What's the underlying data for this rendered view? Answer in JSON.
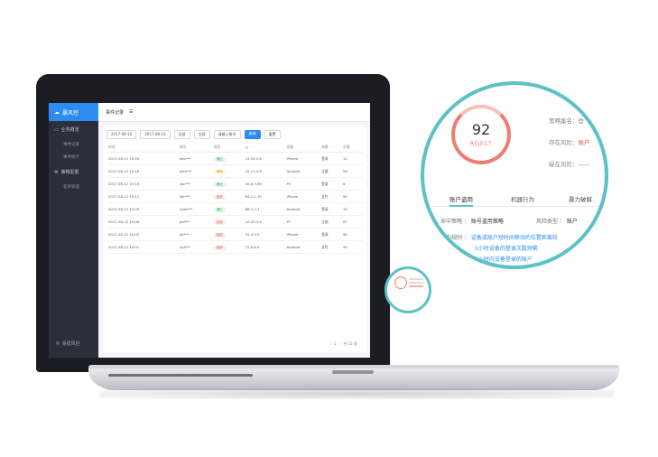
{
  "sidebar": {
    "brand": "暴风控",
    "items": [
      {
        "label": "业务概览",
        "icon": "monitor-icon"
      },
      {
        "label": "事件记录",
        "icon": "list-icon"
      },
      {
        "label": "事件统计",
        "icon": "chart-icon"
      },
      {
        "label": "策略配置",
        "icon": "gear-icon"
      },
      {
        "label": "名单管理",
        "icon": "user-icon"
      }
    ],
    "footer": "易盾风控"
  },
  "topbar": {
    "title": "事件记录"
  },
  "filters": {
    "time": "2017-08-10",
    "to": "2017-08-12",
    "scene": "全部",
    "result": "全部",
    "search_placeholder": "请输入账号",
    "search_button": "查询",
    "reset": "重置"
  },
  "table": {
    "headers": [
      "时间",
      "账号",
      "风险",
      "IP",
      "设备",
      "场景",
      "分值"
    ],
    "rows": [
      [
        "2017-08-12 10:20",
        "abc***",
        "通过",
        "12.34.5.6",
        "iPhone",
        "登录",
        "12"
      ],
      [
        "2017-08-12 10:18",
        "qwe***",
        "审核",
        "22.11.3.8",
        "Android",
        "注册",
        "56"
      ],
      [
        "2017-08-12 10:15",
        "zxc***",
        "通过",
        "45.6.7.89",
        "PC",
        "登录",
        "8"
      ],
      [
        "2017-08-12 10:12",
        "hjk***",
        "拒绝",
        "63.2.1.10",
        "iPhone",
        "支付",
        "92"
      ],
      [
        "2017-08-12 10:09",
        "mnb***",
        "通过",
        "88.1.2.3",
        "Android",
        "登录",
        "15"
      ],
      [
        "2017-08-12 10:06",
        "poi***",
        "拒绝",
        "10.20.3.4",
        "PC",
        "注册",
        "87"
      ],
      [
        "2017-08-12 10:03",
        "lkj***",
        "拒绝",
        "31.4.5.9",
        "iPhone",
        "登录",
        "90"
      ],
      [
        "2017-08-12 10:01",
        "uyt***",
        "拒绝",
        "72.8.6.5",
        "Android",
        "支付",
        "95"
      ]
    ],
    "risk_colors": {
      "通过": "green",
      "审核": "yellow",
      "拒绝": "red"
    }
  },
  "pager": {
    "prev": "‹",
    "page": "1",
    "next": "›",
    "total": "共 12 条"
  },
  "detail": {
    "score": "92",
    "decision": "REJECT",
    "strategy_label": "策略集名：",
    "strategy_value": "登",
    "risk_label": "存在风险：",
    "risk_value": "账户",
    "suspect_label": "疑在风险：",
    "suspect_value": "——",
    "tabs": [
      "账户盗用",
      "机器行为",
      "暴力破解"
    ],
    "hit_label": "命中策略",
    "hit_value": "账号盗用策略",
    "type_label": "风险类型",
    "type_value": "账户",
    "rule_label": "中规则",
    "rules": [
      "设备或账户短时间移动的位置距离较",
      "1小时设备的登录次数频繁",
      "1小时内设备登录的账户"
    ]
  }
}
